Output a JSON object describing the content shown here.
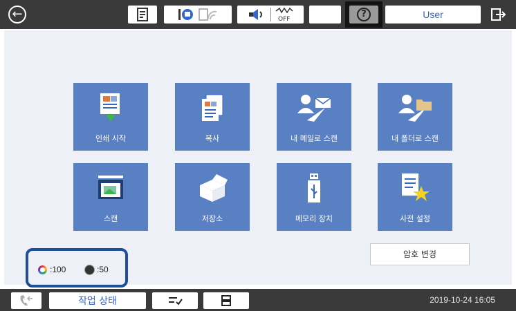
{
  "topbar": {
    "user_label": "User",
    "wifi_status": "wifi-off",
    "sound_status": "volume-on",
    "network_status": "OFF"
  },
  "tiles": [
    {
      "label": "인쇄 시작",
      "icon": "print-from-device-icon"
    },
    {
      "label": "복사",
      "icon": "copy-icon"
    },
    {
      "label": "내 메일로 스캔",
      "icon": "scan-to-my-email-icon"
    },
    {
      "label": "내 폴더로 스캔",
      "icon": "scan-to-my-folder-icon"
    },
    {
      "label": "스캔",
      "icon": "scan-icon"
    },
    {
      "label": "저장소",
      "icon": "storage-box-icon"
    },
    {
      "label": "메모리 장치",
      "icon": "usb-memory-icon"
    },
    {
      "label": "사전 설정",
      "icon": "presets-icon"
    }
  ],
  "password_button": "암호 변경",
  "ink": {
    "color_value": ":100",
    "black_value": ":50"
  },
  "bottombar": {
    "job_status_label": "작업 상태",
    "datetime": "2019-10-24 16:05"
  },
  "colors": {
    "tile": "#5a80c4",
    "bar": "#3a3a3a",
    "accent": "#3566c9",
    "highlight": "#1f4f96"
  }
}
